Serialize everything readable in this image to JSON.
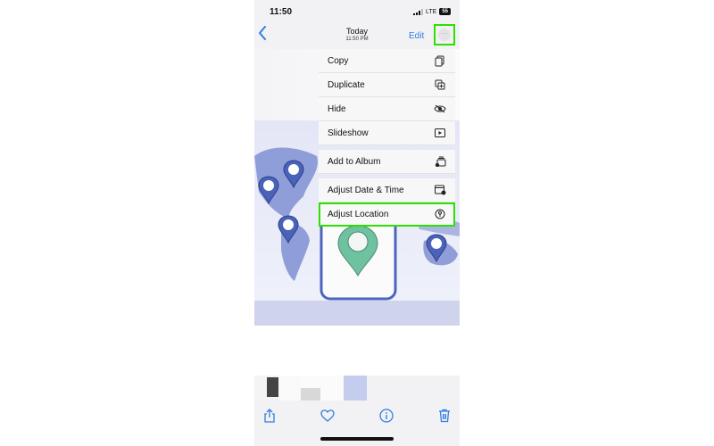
{
  "status_bar": {
    "time": "11:50",
    "network": "LTE",
    "battery": "55"
  },
  "nav": {
    "back_icon": "chevron-left-icon",
    "title": "Today",
    "subtitle": "11:50 PM",
    "edit_label": "Edit",
    "more_icon": "ellipsis-circle-icon"
  },
  "menu": {
    "items": [
      {
        "label": "Copy",
        "icon": "copy-icon"
      },
      {
        "label": "Duplicate",
        "icon": "duplicate-icon"
      },
      {
        "label": "Hide",
        "icon": "eye-slash-icon"
      },
      {
        "label": "Slideshow",
        "icon": "play-rectangle-icon"
      },
      {
        "label": "Add to Album",
        "icon": "add-to-album-icon"
      },
      {
        "label": "Adjust Date & Time",
        "icon": "calendar-clock-icon"
      },
      {
        "label": "Adjust Location",
        "icon": "location-circle-icon"
      }
    ],
    "highlighted": "Adjust Location"
  },
  "highlight_color": "#2ee000",
  "accent_color": "#2f7fe0",
  "toolbar": {
    "share_icon": "share-icon",
    "favorite_icon": "heart-icon",
    "info_icon": "info-icon",
    "delete_icon": "trash-icon"
  }
}
